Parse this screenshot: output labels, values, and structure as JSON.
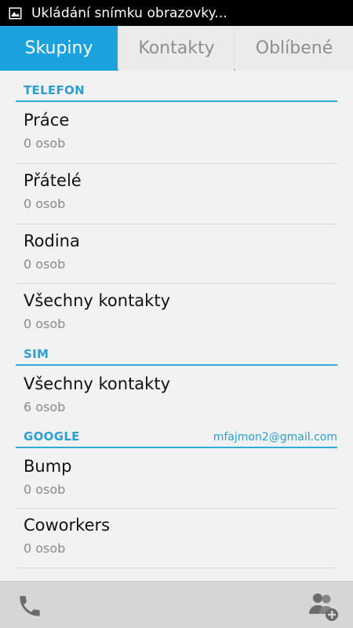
{
  "status_bar": {
    "notification_icon": "image-icon",
    "text": "Ukládání snímku obrazovky..."
  },
  "tabs": [
    {
      "label": "Skupiny",
      "active": true
    },
    {
      "label": "Kontakty",
      "active": false
    },
    {
      "label": "Oblíbené",
      "active": false
    }
  ],
  "sections": {
    "telefon": {
      "title": "TELEFON",
      "groups": [
        {
          "name": "Práce",
          "count": "0 osob"
        },
        {
          "name": "Přátelé",
          "count": "0 osob"
        },
        {
          "name": "Rodina",
          "count": "0 osob"
        },
        {
          "name": "Všechny kontakty",
          "count": "0 osob"
        }
      ]
    },
    "sim": {
      "title": "SIM",
      "groups": [
        {
          "name": "Všechny kontakty",
          "count": "6 osob"
        }
      ]
    },
    "google": {
      "title": "GOOGLE",
      "account": "mfajmon2@gmail.com",
      "groups": [
        {
          "name": "Bump",
          "count": "0 osob"
        },
        {
          "name": "Coworkers",
          "count": "0 osob"
        }
      ]
    }
  },
  "bottom_bar": {
    "left_icon": "phone-icon",
    "right_icon": "add-group-icon"
  },
  "colors": {
    "accent": "#1ba1dd",
    "section_text": "#2e9ed1",
    "status_bar": "#000000"
  }
}
